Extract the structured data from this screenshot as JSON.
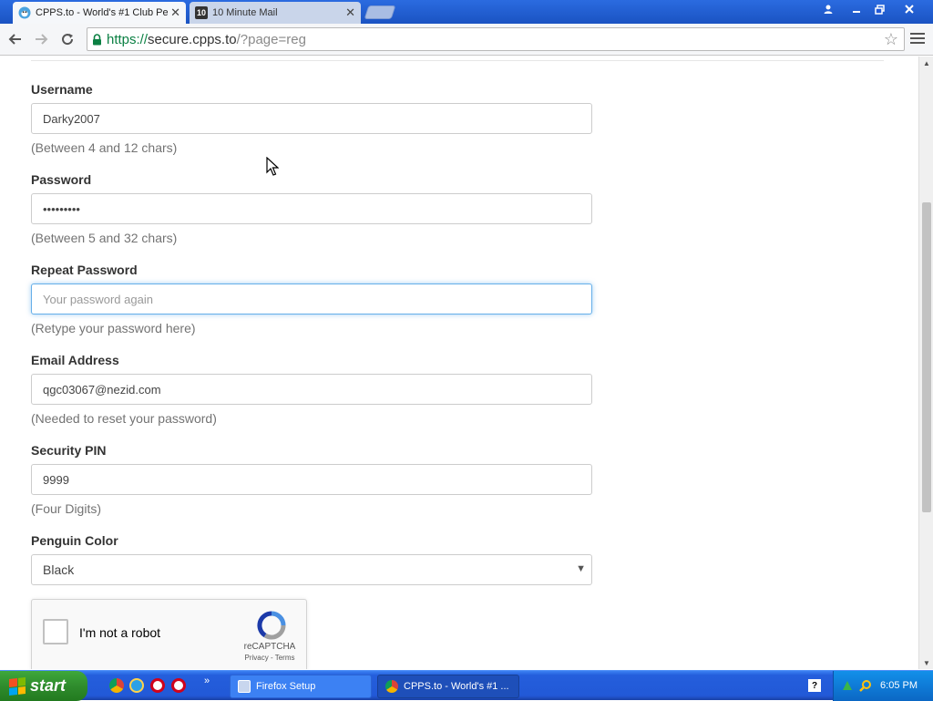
{
  "browser": {
    "tabs": [
      {
        "title": "CPPS.to - World's #1 Club Pe",
        "active": true,
        "favicon": "penguin-icon"
      },
      {
        "title": "10 Minute Mail",
        "active": false,
        "favicon": "10-icon",
        "favicon_text": "10"
      }
    ],
    "url": {
      "scheme": "https://",
      "host": "secure.cpps.to",
      "path": "/?page=reg"
    }
  },
  "form": {
    "username": {
      "label": "Username",
      "value": "Darky2007",
      "hint": "(Between 4 and 12 chars)"
    },
    "password": {
      "label": "Password",
      "value": "•••••••••",
      "hint": "(Between 5 and 32 chars)"
    },
    "repeat_password": {
      "label": "Repeat Password",
      "value": "",
      "placeholder": "Your password again",
      "hint": "(Retype your password here)"
    },
    "email": {
      "label": "Email Address",
      "value": "qgc03067@nezid.com",
      "hint": "(Needed to reset your password)"
    },
    "pin": {
      "label": "Security PIN",
      "value": "9999",
      "hint": "(Four Digits)"
    },
    "penguin_color": {
      "label": "Penguin Color",
      "selected": "Black"
    }
  },
  "captcha": {
    "text": "I'm not a robot",
    "brand": "reCAPTCHA",
    "links": "Privacy - Terms"
  },
  "taskbar": {
    "start_label": "start",
    "quick_launch": [
      "chrome-icon",
      "ie-icon",
      "opera-icon",
      "opera-icon"
    ],
    "tasks": [
      {
        "label": "Firefox Setup",
        "icon": "installer-icon",
        "active": false
      },
      {
        "label": "CPPS.to - World's #1 ...",
        "icon": "chrome-icon",
        "active": true
      }
    ],
    "clock": "6:05 PM"
  },
  "colors": {
    "focus_border": "#66afe9",
    "taskbar_blue": "#245edc",
    "start_green": "#2f8c2d",
    "secure_green": "#0b8043"
  }
}
